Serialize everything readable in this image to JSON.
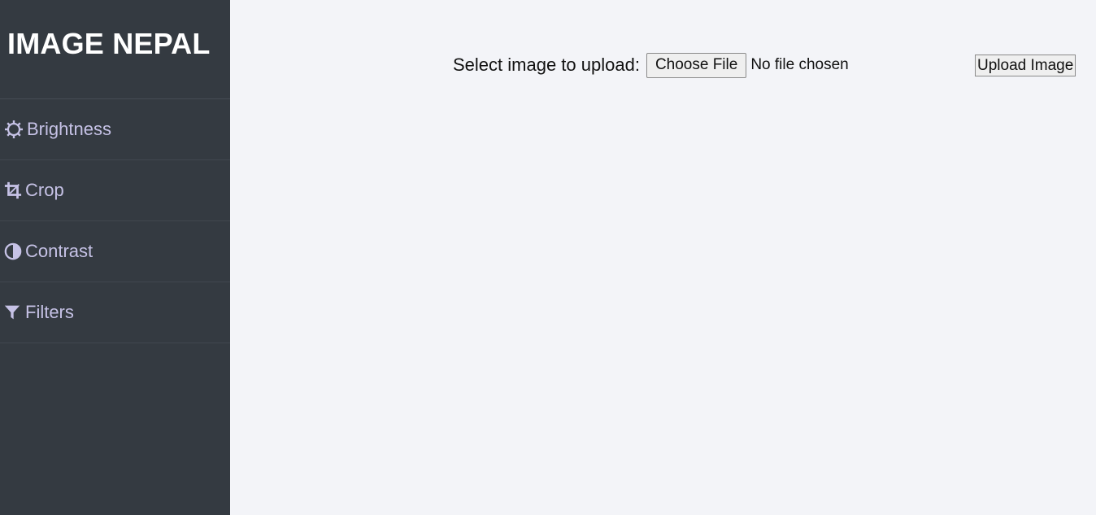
{
  "brand": {
    "title": "IMAGE NEPAL"
  },
  "sidebar": {
    "items": [
      {
        "label": "Brightness",
        "icon": "brightness-icon"
      },
      {
        "label": "Crop",
        "icon": "crop-icon"
      },
      {
        "label": "Contrast",
        "icon": "contrast-icon"
      },
      {
        "label": "Filters",
        "icon": "filter-icon"
      }
    ]
  },
  "upload": {
    "label": "Select image to upload:",
    "choose_button": "Choose File",
    "file_status": "No file chosen",
    "submit_button": "Upload Image"
  },
  "colors": {
    "sidebar_bg": "#343a41",
    "nav_text": "#c6c2e6",
    "main_bg": "#f3f4f8",
    "brand_text": "#ffffff"
  }
}
